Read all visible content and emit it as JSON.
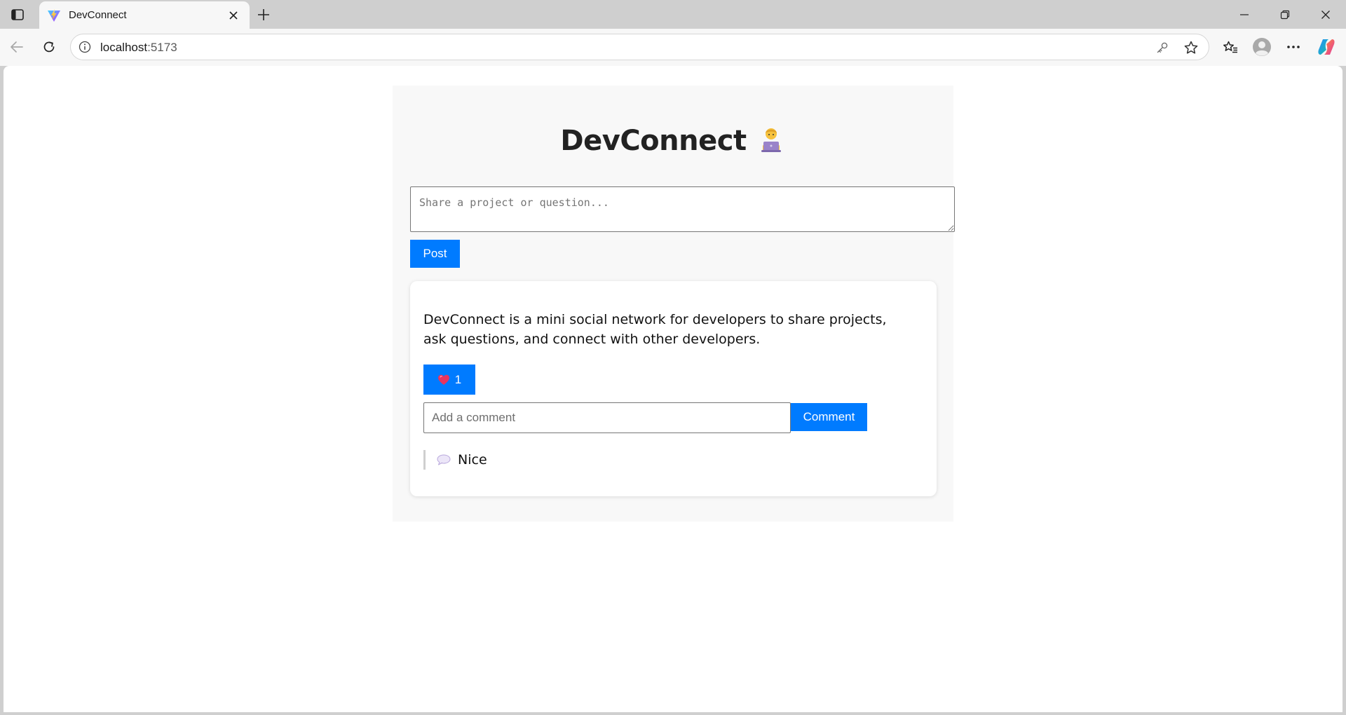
{
  "browser": {
    "tab_title": "DevConnect",
    "url_host": "localhost",
    "url_port": ":5173",
    "icons": {
      "tab_actions": "tab-actions-icon",
      "favicon": "vite-logo-icon",
      "close": "close-icon",
      "new_tab": "plus-icon",
      "back": "back-arrow-icon",
      "refresh": "refresh-icon",
      "site_info": "info-icon",
      "password": "key-icon",
      "favorite": "star-icon",
      "favorites": "favorites-icon",
      "profile": "profile-icon",
      "menu": "more-icon",
      "copilot": "copilot-icon"
    }
  },
  "app": {
    "title": "DevConnect",
    "title_emoji": "technologist-emoji",
    "composer": {
      "placeholder": "Share a project or question...",
      "value": "",
      "post_label": "Post"
    },
    "posts": [
      {
        "text": "DevConnect is a mini social network for developers to share projects, ask questions, and connect with other developers.",
        "likes": "1",
        "like_icon": "heart-icon",
        "comment_placeholder": "Add a comment",
        "comment_value": "",
        "comment_button_label": "Comment",
        "comments": [
          {
            "icon": "speech-bubble-icon",
            "text": "Nice"
          }
        ]
      }
    ]
  },
  "colors": {
    "accent": "#007bff",
    "app_background": "#f8f8f8",
    "card_background": "#ffffff"
  }
}
